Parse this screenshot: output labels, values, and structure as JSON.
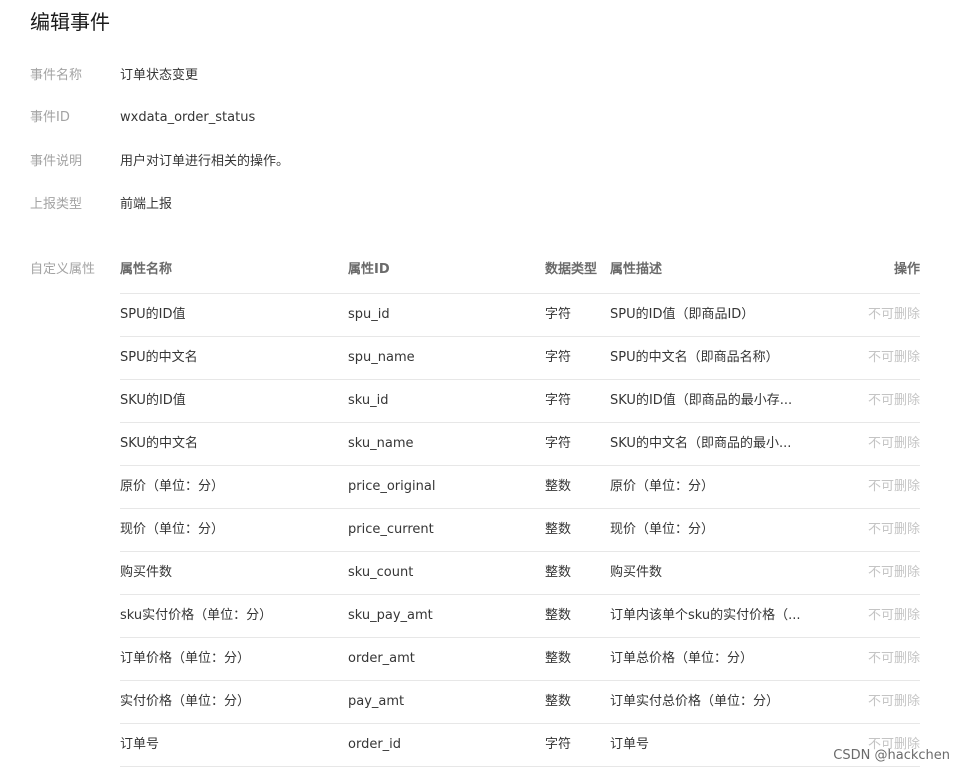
{
  "page": {
    "title": "编辑事件"
  },
  "info": [
    {
      "label": "事件名称",
      "value": "订单状态变更"
    },
    {
      "label": "事件ID",
      "value": "wxdata_order_status"
    },
    {
      "label": "事件说明",
      "value": "用户对订单进行相关的操作。"
    },
    {
      "label": "上报类型",
      "value": "前端上报"
    }
  ],
  "attributes": {
    "section_label": "自定义属性",
    "headers": {
      "name": "属性名称",
      "id": "属性ID",
      "type": "数据类型",
      "desc": "属性描述",
      "op": "操作"
    },
    "rows": [
      {
        "name": "SPU的ID值",
        "id": "spu_id",
        "type": "字符",
        "desc": "SPU的ID值（即商品ID）",
        "op": "不可删除"
      },
      {
        "name": "SPU的中文名",
        "id": "spu_name",
        "type": "字符",
        "desc": "SPU的中文名（即商品名称）",
        "op": "不可删除"
      },
      {
        "name": "SKU的ID值",
        "id": "sku_id",
        "type": "字符",
        "desc": "SKU的ID值（即商品的最小存...",
        "op": "不可删除"
      },
      {
        "name": "SKU的中文名",
        "id": "sku_name",
        "type": "字符",
        "desc": "SKU的中文名（即商品的最小...",
        "op": "不可删除"
      },
      {
        "name": "原价（单位：分）",
        "id": "price_original",
        "type": "整数",
        "desc": "原价（单位：分）",
        "op": "不可删除"
      },
      {
        "name": "现价（单位：分）",
        "id": "price_current",
        "type": "整数",
        "desc": "现价（单位：分）",
        "op": "不可删除"
      },
      {
        "name": "购买件数",
        "id": "sku_count",
        "type": "整数",
        "desc": "购买件数",
        "op": "不可删除"
      },
      {
        "name": "sku实付价格（单位：分）",
        "id": "sku_pay_amt",
        "type": "整数",
        "desc": "订单内该单个sku的实付价格（...",
        "op": "不可删除"
      },
      {
        "name": "订单价格（单位：分）",
        "id": "order_amt",
        "type": "整数",
        "desc": "订单总价格（单位：分）",
        "op": "不可删除"
      },
      {
        "name": "实付价格（单位：分）",
        "id": "pay_amt",
        "type": "整数",
        "desc": "订单实付总价格（单位：分）",
        "op": "不可删除"
      },
      {
        "name": "订单号",
        "id": "order_id",
        "type": "字符",
        "desc": "订单号",
        "op": "不可删除"
      }
    ]
  },
  "watermark": "CSDN @hackchen"
}
